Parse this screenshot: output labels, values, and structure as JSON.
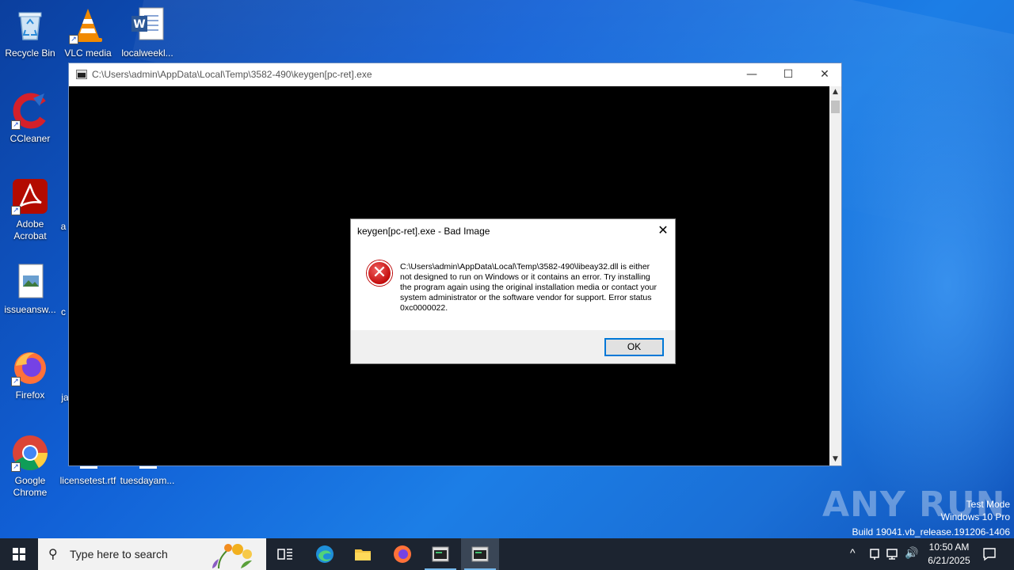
{
  "desktop": {
    "icons": [
      {
        "label": "Recycle Bin",
        "icon": "recycle-bin-icon"
      },
      {
        "label": "VLC media",
        "icon": "vlc-icon"
      },
      {
        "label": "localweekl...",
        "icon": "word-document-icon"
      },
      {
        "label": "CCleaner",
        "icon": "ccleaner-icon"
      },
      {
        "label": "Adobe Acrobat",
        "icon": "adobe-acrobat-icon"
      },
      {
        "label": "issueansw...",
        "icon": "image-file-icon"
      },
      {
        "label": "Firefox",
        "icon": "firefox-icon"
      },
      {
        "label": "Google Chrome",
        "icon": "chrome-icon"
      },
      {
        "label": "licensetest.rtf",
        "icon": "rtf-file-icon"
      },
      {
        "label": "tuesdayam...",
        "icon": "file-icon"
      }
    ],
    "partial_labels": [
      "a",
      "c",
      "ja"
    ]
  },
  "console_window": {
    "title": "C:\\Users\\admin\\AppData\\Local\\Temp\\3582-490\\keygen[pc-ret].exe",
    "minimize": "—",
    "maximize": "☐",
    "close": "✕"
  },
  "dialog": {
    "title": "keygen[pc-ret].exe - Bad Image",
    "close": "✕",
    "message": "C:\\Users\\admin\\AppData\\Local\\Temp\\3582-490\\libeay32.dll is either not designed to run on Windows or it contains an error. Try installing the program again using the original installation media or contact your system administrator or the software vendor for support. Error status 0xc0000022.",
    "ok_label": "OK",
    "icon": "error-icon"
  },
  "watermark": {
    "brand": "ANY RUN",
    "line1": "Test Mode",
    "line2": "Windows 10 Pro",
    "line3": "Build 19041.vb_release.191206-1406"
  },
  "taskbar": {
    "search_placeholder": "Type here to search",
    "apps": [
      "task-view-icon",
      "edge-icon",
      "file-explorer-icon",
      "firefox-icon",
      "console-app-icon",
      "console-app-icon-active"
    ],
    "clock_time": "10:50 AM",
    "clock_date": "6/21/2025"
  },
  "colors": {
    "desktop": "#1160d6",
    "taskbar": "#1c2430",
    "accent": "#0078d7",
    "error": "#c40d0d"
  }
}
